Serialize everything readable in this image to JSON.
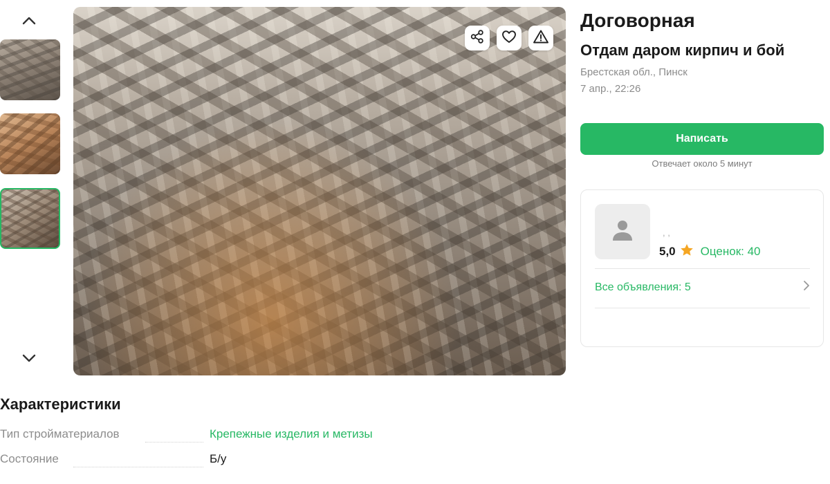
{
  "gallery": {
    "up_icon": "chevron-up-icon",
    "down_icon": "chevron-down-icon",
    "thumbnails": [
      {
        "icon": "photo-thumbnail",
        "selected": false
      },
      {
        "icon": "photo-thumbnail",
        "selected": false
      },
      {
        "icon": "photo-thumbnail",
        "selected": true
      }
    ],
    "actions": [
      "share-icon",
      "heart-icon",
      "warning-icon"
    ]
  },
  "listing": {
    "price": "Договорная",
    "title": "Отдам даром кирпич и бой",
    "location": "Брестская обл., Пинск",
    "date": "7 апр., 22:26",
    "write_button": "Написать",
    "reply_note": "Отвечает около 5 минут"
  },
  "seller": {
    "name": ", ,",
    "rating": "5,0",
    "reviews": "Оценок: 40",
    "all_ads": "Все объявления: 5"
  },
  "specs": {
    "title": "Характеристики",
    "rows": [
      {
        "label": "Тип стройматериалов",
        "value": "Крепежные изделия и метизы"
      },
      {
        "label": "Состояние",
        "value": "Б/у"
      }
    ]
  },
  "colors": {
    "accent": "#27b864",
    "star": "#f5a623",
    "muted": "#8c8c8c"
  }
}
